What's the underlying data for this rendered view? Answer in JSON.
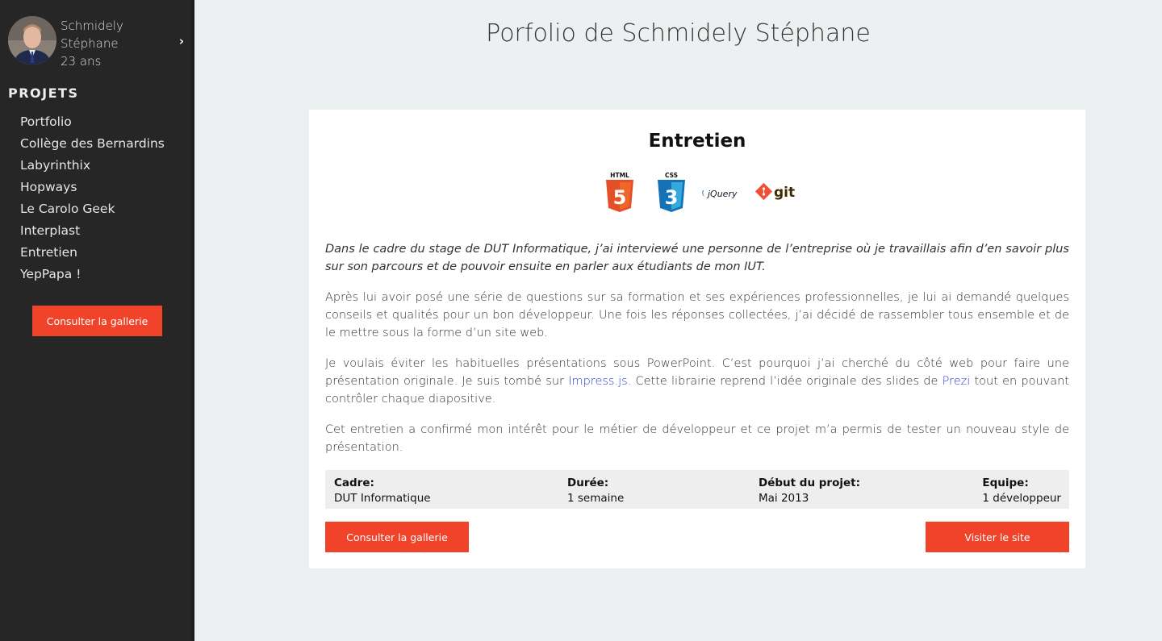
{
  "profile": {
    "first_line": "Schmidely",
    "second_line": "Stéphane",
    "age": "23 ans"
  },
  "sidebar": {
    "section_title": "PROJETS",
    "items": [
      {
        "label": "Portfolio"
      },
      {
        "label": "Collège des Bernardins"
      },
      {
        "label": "Labyrinthix"
      },
      {
        "label": "Hopways"
      },
      {
        "label": "Le Carolo Geek"
      },
      {
        "label": "Interplast"
      },
      {
        "label": "Entretien"
      },
      {
        "label": "YepPapa !"
      }
    ],
    "gallery_button": "Consulter la gallerie"
  },
  "page": {
    "title": "Porfolio de Schmidely Stéphane"
  },
  "project": {
    "title": "Entretien",
    "technologies": [
      {
        "icon": "html5-icon",
        "label": "HTML"
      },
      {
        "icon": "css3-icon",
        "label": "CSS"
      },
      {
        "icon": "jquery-icon",
        "label": "jQuery"
      },
      {
        "icon": "git-icon",
        "label": "git"
      }
    ],
    "intro": "Dans le cadre du stage de DUT Informatique, j’ai interviewé une personne de l’entreprise où je travaillais afin d’en savoir plus sur son parcours et de pouvoir ensuite en parler aux étudiants de mon IUT.",
    "paragraph_2": "Après lui avoir posé une série de questions sur sa formation et ses expériences professionnelles, je lui ai demandé quelques conseils et qualités pour un bon développeur. Une fois les réponses collectées, j’ai décidé de rassembler tous ensemble et de le mettre sous la forme d’un site web.",
    "paragraph_3": {
      "part_1": "Je voulais éviter les habituelles présentations sous PowerPoint. C’est pourquoi j’ai cherché du côté web pour faire une présentation originale. Je suis tombé sur ",
      "link_1": "Impress.js",
      "part_2": ". Cette librairie reprend l’idée originale des slides de ",
      "link_2": "Prezi",
      "part_3": " tout en pouvant contrôler chaque diapositive."
    },
    "paragraph_4": "Cet entretien a confirmé mon intérêt pour le métier de développeur et ce projet m’a permis de tester un nouveau style de présentation.",
    "info": {
      "cadre_label": "Cadre:",
      "cadre_value": "DUT Informatique",
      "duree_label": "Durée:",
      "duree_value": "1 semaine",
      "debut_label": "Début du projet:",
      "debut_value": "Mai 2013",
      "equipe_label": "Equipe:",
      "equipe_value": "1 développeur"
    },
    "gallery_button": "Consulter la gallerie",
    "visit_button": "Visiter le site"
  },
  "colors": {
    "accent": "#f0432a",
    "sidebar_bg": "#262626",
    "page_bg": "#ecf0f1",
    "link": "#2c3fd1"
  }
}
